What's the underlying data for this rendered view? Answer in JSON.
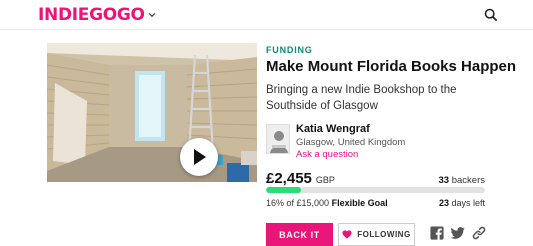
{
  "header": {
    "logo_text": "INDIEGOGO",
    "logo_icon": "chevron-down-icon",
    "search_icon": "search-icon",
    "brand_color": "#eb1478"
  },
  "campaign": {
    "status": "FUNDING",
    "title": "Make Mount Florida Books Happen",
    "tagline": "Bringing a new Indie Bookshop to the Southside of Glasgow",
    "media": {
      "type": "video",
      "play_icon": "play-icon"
    }
  },
  "owner": {
    "name": "Katia Wengraf",
    "location": "Glasgow, United Kingdom",
    "ask_label": "Ask a question"
  },
  "funding": {
    "raised": "£2,455",
    "currency": "GBP",
    "backers_count": "33",
    "backers_label": "backers",
    "percent_text": "16% of £15,000",
    "goal_type": "Flexible Goal",
    "days_left": "23",
    "days_label": "days left",
    "progress_fraction": 0.16,
    "progress_color": "#2bde73"
  },
  "actions": {
    "back_label": "BACK IT",
    "follow_label": "FOLLOWING",
    "follow_icon": "heart-icon",
    "share_icons": [
      "facebook-icon",
      "twitter-icon",
      "link-icon"
    ]
  }
}
